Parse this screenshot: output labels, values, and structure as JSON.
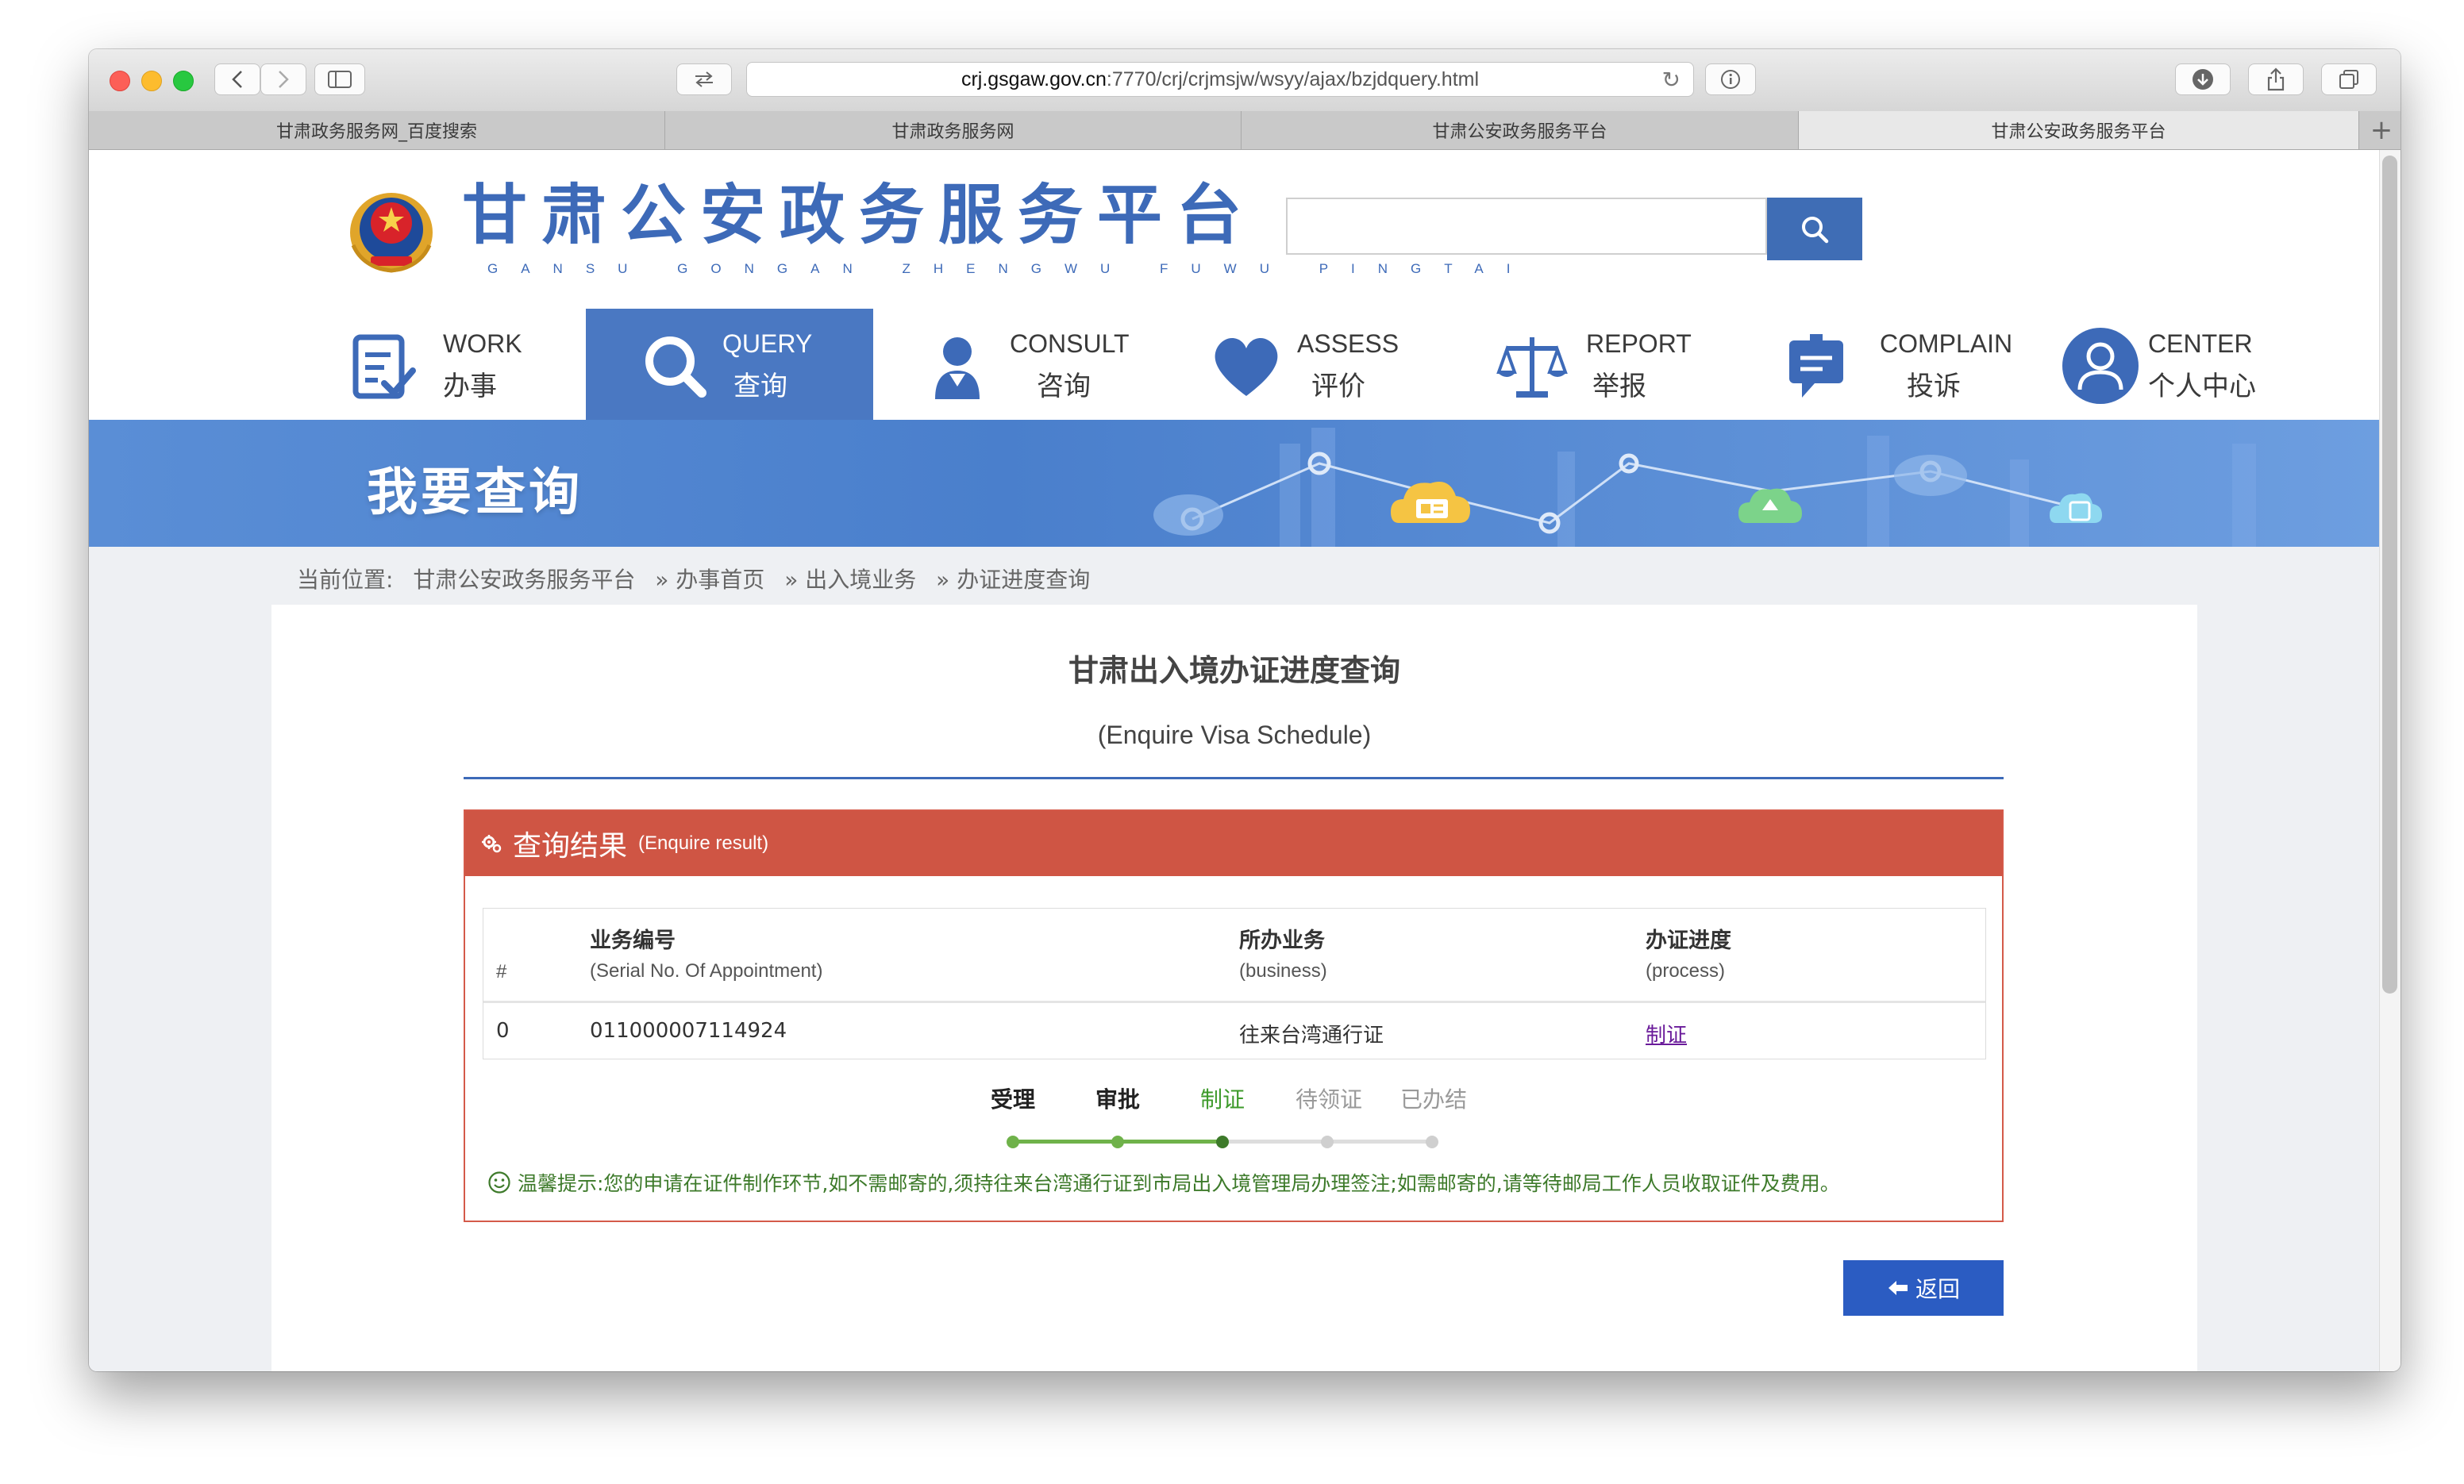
{
  "browser": {
    "url_host": "crj.gsgaw.gov.cn",
    "url_rest": ":7770/crj/crjmsjw/wsyy/ajax/bzjdquery.html",
    "tabs": [
      {
        "label": "甘肃政务服务网_百度搜索",
        "active": false
      },
      {
        "label": "甘肃政务服务网",
        "active": false
      },
      {
        "label": "甘肃公安政务服务平台",
        "active": false
      },
      {
        "label": "甘肃公安政务服务平台",
        "active": true
      }
    ]
  },
  "header": {
    "site_title": "甘肃公安政务服务平台",
    "pinyin": "GANSU GONGAN ZHENGWU FUWU PINGTAI",
    "search_placeholder": ""
  },
  "nav": [
    {
      "en": "WORK",
      "cn": "办事",
      "icon": "work-form-icon",
      "active": false
    },
    {
      "en": "QUERY",
      "cn": "查询",
      "icon": "search-icon",
      "active": true
    },
    {
      "en": "CONSULT",
      "cn": "咨询",
      "icon": "consult-person-icon",
      "active": false
    },
    {
      "en": "ASSESS",
      "cn": "评价",
      "icon": "heart-icon",
      "active": false
    },
    {
      "en": "REPORT",
      "cn": "举报",
      "icon": "scales-icon",
      "active": false
    },
    {
      "en": "COMPLAIN",
      "cn": "投诉",
      "icon": "chat-board-icon",
      "active": false
    },
    {
      "en": "CENTER",
      "cn": "个人中心",
      "icon": "user-icon",
      "active": false
    }
  ],
  "banner": {
    "title": "我要查询"
  },
  "breadcrumb": {
    "prefix": "当前位置:",
    "items": [
      "甘肃公安政务服务平台",
      "» 办事首页",
      "» 出入境业务",
      "» 办证进度查询"
    ]
  },
  "content": {
    "title": "甘肃出入境办证进度查询",
    "subtitle": "(Enquire Visa Schedule)",
    "result_title_cn": "查询结果",
    "result_title_en": "(Enquire result)",
    "table": {
      "columns": [
        {
          "cn": "",
          "en": "#"
        },
        {
          "cn": "业务编号",
          "en": "(Serial No. Of Appointment)"
        },
        {
          "cn": "所办业务",
          "en": "(business)"
        },
        {
          "cn": "办证进度",
          "en": "(process)"
        }
      ],
      "rows": [
        {
          "index": "0",
          "serial": "011000007114924",
          "business": "往来台湾通行证",
          "process": "制证"
        }
      ]
    },
    "steps": [
      {
        "label": "受理",
        "state": "done"
      },
      {
        "label": "审批",
        "state": "done"
      },
      {
        "label": "制证",
        "state": "current"
      },
      {
        "label": "待领证",
        "state": "pending"
      },
      {
        "label": "已办结",
        "state": "pending"
      }
    ],
    "tip": "温馨提示:您的申请在证件制作环节,如不需邮寄的,须持往来台湾通行证到市局出入境管理局办理签注;如需邮寄的,请等待邮局工作人员收取证件及费用。",
    "back_label": "返回"
  },
  "colors": {
    "brand_blue": "#3d6ab8",
    "result_red": "#cf5544",
    "step_green": "#6fb24a",
    "tip_green": "#3d7a2a"
  }
}
